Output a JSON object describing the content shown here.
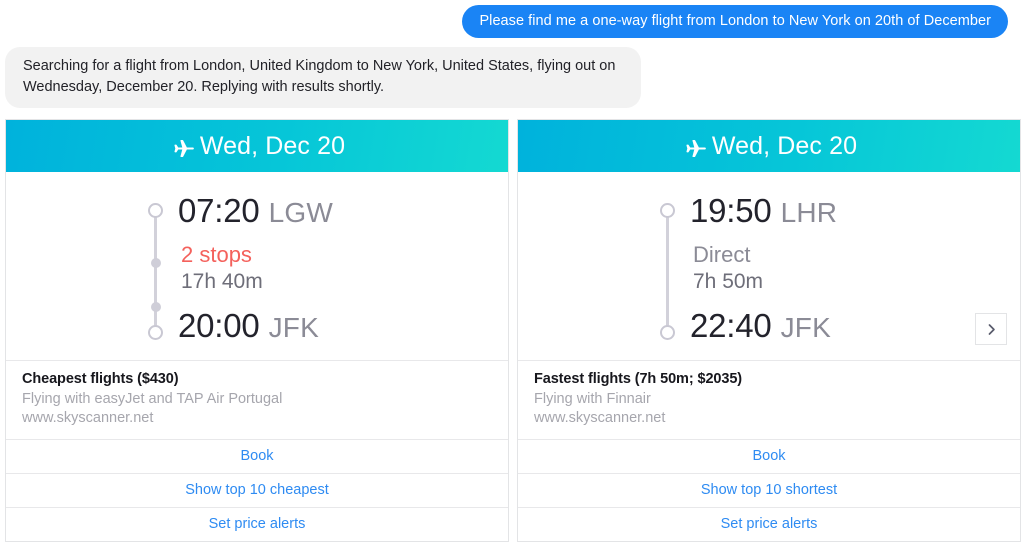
{
  "conversation": {
    "user_message": "Please find me a one-way flight from London to New York on 20th of December",
    "bot_message": "Searching for a flight from London, United Kingdom to New York, United States, flying out on Wednesday, December 20. Replying with results shortly."
  },
  "colors": {
    "user_bubble": "#1a84f5",
    "bot_bubble": "#f2f2f2",
    "header_gradient_start": "#00b2dc",
    "header_gradient_end": "#14d9d2",
    "stops_warning": "#f4615c",
    "link": "#2e8bf2",
    "muted_text": "#a6a6ad"
  },
  "carousel": {
    "next_button_label": "›",
    "next_button_icon": "chevron-right-icon",
    "cards": [
      {
        "header": {
          "icon": "airplane-icon",
          "date": "Wed, Dec 20"
        },
        "itinerary": {
          "depart_time": "07:20",
          "depart_code": "LGW",
          "stops": "2 stops",
          "stops_count": 2,
          "duration": "17h 40m",
          "arrive_time": "20:00",
          "arrive_code": "JFK"
        },
        "summary": {
          "title": "Cheapest flights ($430)",
          "airlines": "Flying with easyJet and TAP Air Portugal",
          "url": "www.skyscanner.net"
        },
        "actions": [
          "Book",
          "Show top 10 cheapest",
          "Set price alerts"
        ]
      },
      {
        "header": {
          "icon": "airplane-icon",
          "date": "Wed, Dec 20"
        },
        "itinerary": {
          "depart_time": "19:50",
          "depart_code": "LHR",
          "stops": "Direct",
          "stops_count": 0,
          "duration": "7h 50m",
          "arrive_time": "22:40",
          "arrive_code": "JFK"
        },
        "summary": {
          "title": "Fastest flights (7h 50m; $2035)",
          "airlines": "Flying with Finnair",
          "url": "www.skyscanner.net"
        },
        "actions": [
          "Book",
          "Show top 10 shortest",
          "Set price alerts"
        ]
      }
    ]
  }
}
